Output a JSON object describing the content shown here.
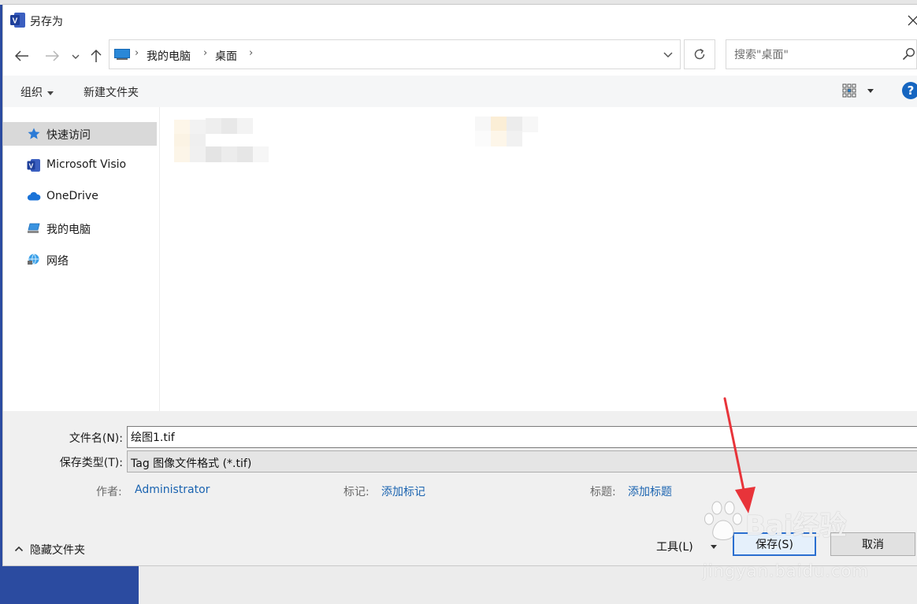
{
  "window": {
    "title": "另存为",
    "close_glyph": "X"
  },
  "nav": {
    "back_icon": "arrow-left-icon",
    "forward_icon": "arrow-right-icon",
    "recent_icon": "chevron-down-icon",
    "up_icon": "arrow-up-icon",
    "breadcrumbs": [
      "我的电脑",
      "桌面"
    ],
    "refresh_icon": "refresh-icon",
    "search_placeholder": "搜索\"桌面\""
  },
  "toolbar": {
    "organize_label": "组织",
    "new_folder_label": "新建文件夹",
    "help_label": "?"
  },
  "sidebar": {
    "items": [
      {
        "label": "快速访问",
        "icon": "star-icon",
        "selected": true
      },
      {
        "label": "Microsoft Visio",
        "icon": "visio-icon",
        "selected": false
      },
      {
        "label": "OneDrive",
        "icon": "cloud-icon",
        "selected": false
      },
      {
        "label": "我的电脑",
        "icon": "computer-icon",
        "selected": false
      },
      {
        "label": "网络",
        "icon": "network-icon",
        "selected": false
      }
    ]
  },
  "form": {
    "filename_label": "文件名(N):",
    "filename_value": "绘图1.tif",
    "filetype_label": "保存类型(T):",
    "filetype_value": "Tag 图像文件格式 (*.tif)",
    "author_label": "作者:",
    "author_value": "Administrator",
    "tags_label": "标记:",
    "tags_value": "添加标记",
    "title_label": "标题:",
    "title_value": "添加标题"
  },
  "footer": {
    "hide_folders_label": "隐藏文件夹",
    "tools_label": "工具(L)",
    "save_label": "保存(S)",
    "cancel_label": "取消"
  },
  "watermark": {
    "brand": "Bai经验",
    "url": "jingyan.baidu.com"
  },
  "colors": {
    "accent": "#2a6fd0",
    "link": "#1a63b0",
    "annotation_arrow": "#e8343a"
  }
}
